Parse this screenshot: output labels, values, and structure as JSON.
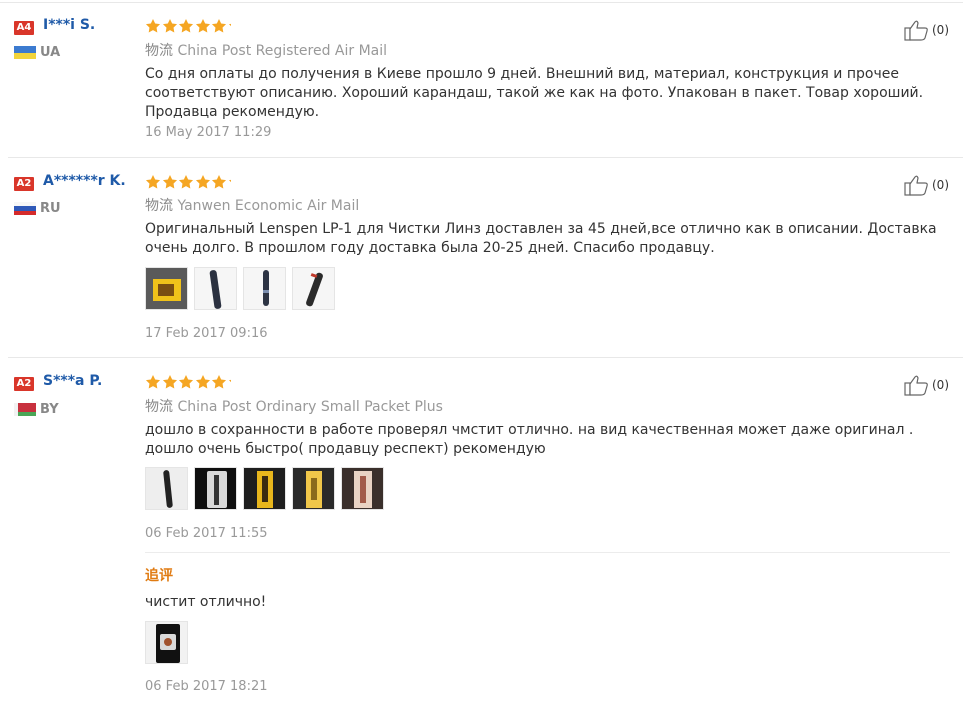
{
  "reviews": [
    {
      "badge": "A4",
      "user": "I***i S.",
      "country": "UA",
      "likes": "(0)",
      "shipping_key": "物流",
      "shipping": "China Post Registered Air Mail",
      "text": "Со дня оплаты до получения в Киеве прошло 9 дней. Внешний вид, материал, конструкция и прочее соответствуют описанию. Хороший карандаш, такой же как на фото. Упакован в пакет. Товар хороший. Продавца рекомендую.",
      "date": "16 May 2017 11:29",
      "rating": 5,
      "photos": []
    },
    {
      "badge": "A2",
      "user": "A******r K.",
      "country": "RU",
      "likes": "(0)",
      "shipping_key": "物流",
      "shipping": "Yanwen Economic Air Mail",
      "text": "Оригинальный Lenspen LP-1 для Чистки Линз доставлен за 45 дней,все отлично как в описании. Доставка очень долго. В прошлом году доставка была 20-25 дней. Спасибо продавцу.",
      "date": "17 Feb 2017 09:16",
      "rating": 5,
      "photos": [
        "photo-1",
        "photo-2",
        "photo-3",
        "photo-4"
      ]
    },
    {
      "badge": "A2",
      "user": "S***a P.",
      "country": "BY",
      "likes": "(0)",
      "shipping_key": "物流",
      "shipping": "China Post Ordinary Small Packet Plus",
      "text": "дошло в сохранности в работе проверял чмстит отлично. на вид качественная может даже оригинал . дошло очень быстро( продавцу респект) рекомендую",
      "date": "06 Feb 2017 11:55",
      "rating": 5,
      "photos": [
        "photo-1",
        "photo-2",
        "photo-3",
        "photo-4",
        "photo-5"
      ],
      "additional": {
        "title": "追评",
        "text": "чистит отлично!",
        "date": "06 Feb 2017 18:21",
        "photos": [
          "photo-1"
        ]
      }
    }
  ],
  "colors": {
    "username": "#1f5aa8",
    "badge": "#d9362a",
    "star": "#f5a623",
    "additional_title": "#e07b12",
    "muted": "#999999"
  },
  "icons": {
    "like": "thumbs-up-icon",
    "star": "star-icon"
  }
}
